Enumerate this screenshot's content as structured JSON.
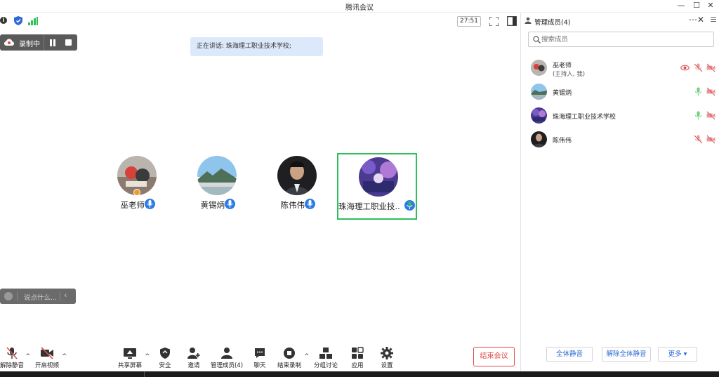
{
  "window": {
    "title": "腾讯会议"
  },
  "status": {
    "timer": "27:51"
  },
  "recording": {
    "label": "录制中"
  },
  "speaking": {
    "text": "正在讲话: 珠海理工职业技术学校;"
  },
  "participants": [
    {
      "name": "巫老师",
      "mic": "mic-on-icon",
      "host": true
    },
    {
      "name": "黄锡炳",
      "mic": "mic-on-icon"
    },
    {
      "name": "陈伟伟",
      "mic": "mic-on-icon"
    },
    {
      "name": "珠海理工职业技...",
      "mic": "mic-speaking-icon",
      "active": true
    }
  ],
  "chat_hint": {
    "placeholder": "说点什么..."
  },
  "toolbar": {
    "unmute": "解除静音",
    "start_video": "开启视频",
    "share_screen": "共享屏幕",
    "security": "安全",
    "invite": "邀请",
    "manage_members": "管理成员(4)",
    "chat": "聊天",
    "end_recording": "结束录制",
    "breakout": "分组讨论",
    "apps": "应用",
    "settings": "设置",
    "end_meeting": "结束会议"
  },
  "panel": {
    "title": "管理成员(4)",
    "search_placeholder": "搜索成员",
    "members": [
      {
        "name": "巫老师",
        "subtitle": "(主持人, 我)"
      },
      {
        "name": "黄锡炳"
      },
      {
        "name": "珠海理工职业技术学校"
      },
      {
        "name": "陈伟伟"
      }
    ],
    "mute_all": "全体静音",
    "unmute_all": "解除全体静音",
    "more": "更多 ▾"
  },
  "colors": {
    "accent_blue": "#2d7be5",
    "speaking_green": "#2fbf5a",
    "danger_red": "#e14b4b",
    "speaking_banner": "#dce9fb"
  }
}
